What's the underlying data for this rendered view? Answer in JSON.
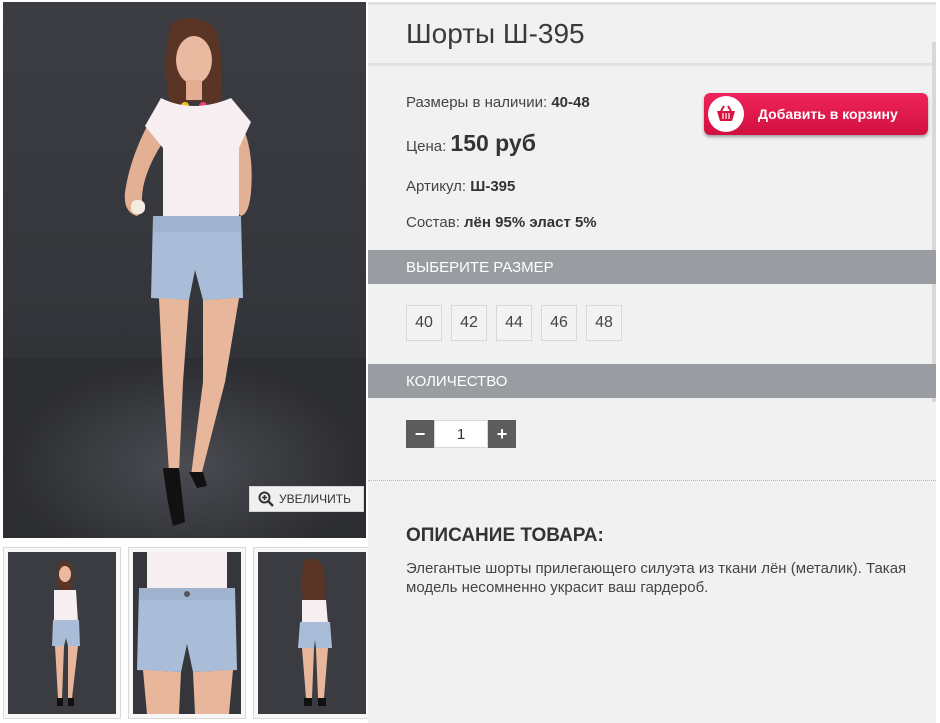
{
  "gallery": {
    "zoom_label": "УВЕЛИЧИТЬ",
    "zoom_icon": "zoom-in-icon",
    "thumbnails": [
      "front-view",
      "close-up-view",
      "back-view"
    ]
  },
  "product": {
    "title": "Шорты Ш-395",
    "sizes_label": "Размеры в наличии:",
    "sizes_value": "40-48",
    "price_label": "Цена:",
    "price_value": "150 руб",
    "sku_label": "Артикул:",
    "sku_value": "Ш-395",
    "composition_label": "Состав:",
    "composition_value": "лён 95% эласт 5%"
  },
  "cart": {
    "add_label": "Добавить в корзину",
    "icon": "basket-icon",
    "color": "#e0174d"
  },
  "size_picker": {
    "heading": "ВЫБЕРИТЕ РАЗМЕР",
    "options": [
      "40",
      "42",
      "44",
      "46",
      "48"
    ]
  },
  "quantity": {
    "heading": "КОЛИЧЕСТВО",
    "minus": "−",
    "value": "1",
    "plus": "+"
  },
  "description": {
    "heading": "ОПИСАНИЕ ТОВАРА:",
    "text": "Элегантые шорты прилегающего силуэта из ткани лён (металик). Такая модель несомненно украсит ваш гардероб."
  }
}
